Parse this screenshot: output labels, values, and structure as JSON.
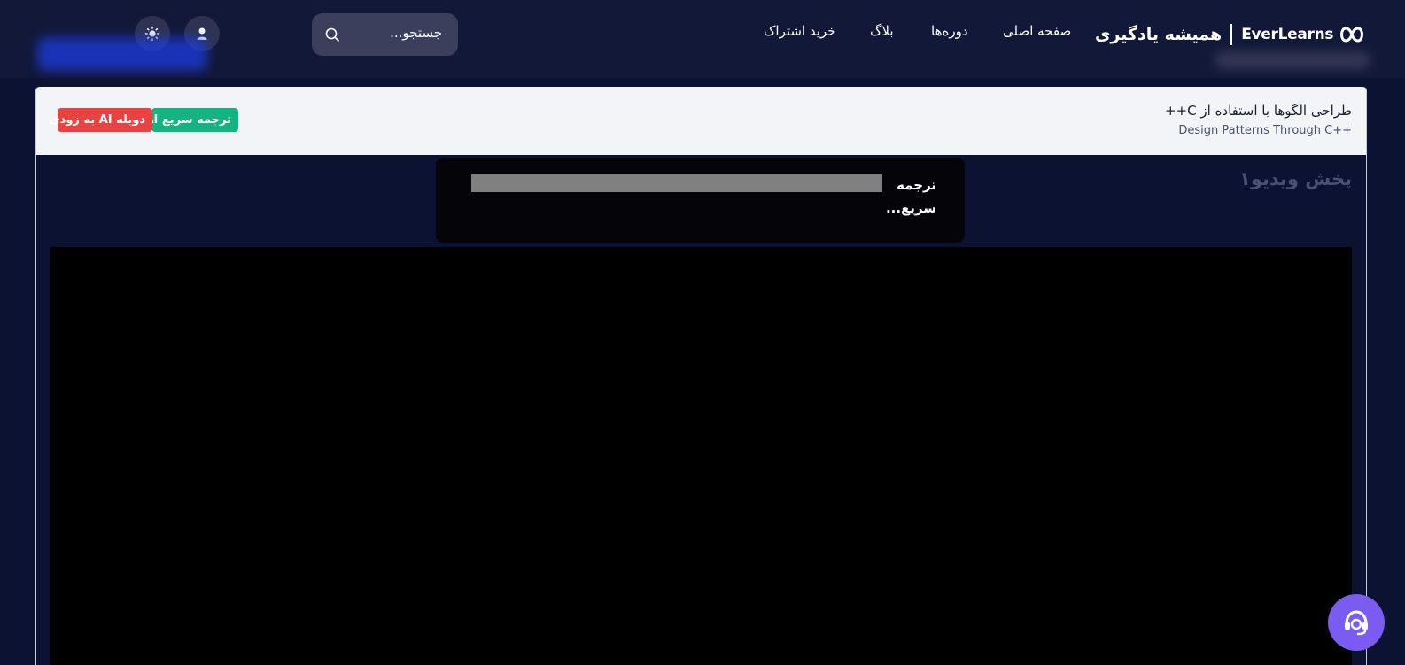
{
  "header": {
    "logo_fa": "همیشه یادگیری",
    "logo_en": "EverLearns",
    "nav": {
      "home": "صفحه اصلی",
      "courses": "دوره‌ها",
      "blog": "بلاگ",
      "subscribe": "خرید اشتراک"
    },
    "search": {
      "placeholder": "جستجو..."
    }
  },
  "course": {
    "title": "طراحی الگوها با استفاده از C++",
    "subtitle": "Design Patterns Through C++",
    "badges": {
      "translate": "ترجمه سریع AI",
      "dub": "دوبله AI به زودی"
    }
  },
  "player": {
    "section_title": "پخش ویدیو۱",
    "overlay_label": "ترجمه سریع...",
    "translation_progress": 1.0
  },
  "colors": {
    "background": "#0c1231",
    "header": "#111838",
    "badge_translate": "#12b57f",
    "badge_dub": "#ea4141",
    "support": "#7a5cf0"
  }
}
